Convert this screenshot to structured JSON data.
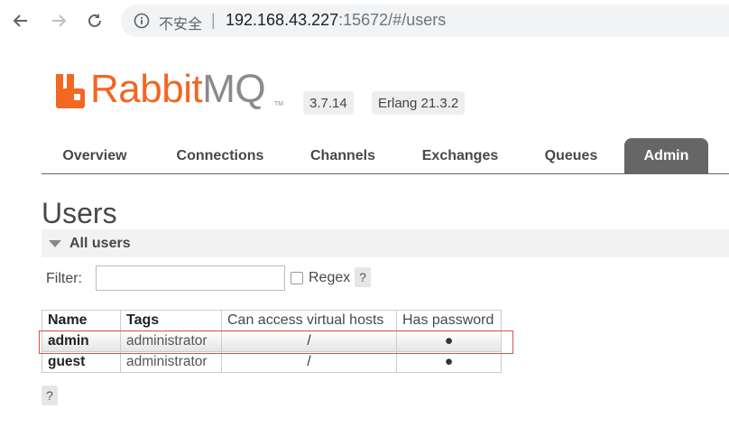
{
  "browser": {
    "security_label": "不安全",
    "separator": "|",
    "url_host": "192.168.43.227",
    "url_rest": ":15672/#/users"
  },
  "header": {
    "logo_rabbit": "Rabbit",
    "logo_mq": "MQ",
    "logo_tm": "TM",
    "version": "3.7.14",
    "erlang": "Erlang 21.3.2"
  },
  "tabs": [
    {
      "label": "Overview",
      "active": false
    },
    {
      "label": "Connections",
      "active": false
    },
    {
      "label": "Channels",
      "active": false
    },
    {
      "label": "Exchanges",
      "active": false
    },
    {
      "label": "Queues",
      "active": false
    },
    {
      "label": "Admin",
      "active": true
    }
  ],
  "page": {
    "title": "Users",
    "section": "All users",
    "filter_label": "Filter:",
    "filter_value": "",
    "regex_label": "Regex",
    "help": "?"
  },
  "table": {
    "headers": [
      "Name",
      "Tags",
      "Can access virtual hosts",
      "Has password"
    ],
    "rows": [
      {
        "name": "admin",
        "tags": "administrator",
        "vhosts": "/",
        "has_password": "●"
      },
      {
        "name": "guest",
        "tags": "administrator",
        "vhosts": "/",
        "has_password": "●"
      }
    ]
  },
  "colors": {
    "brand_orange": "#f26722",
    "active_tab": "#666666",
    "highlight_border": "#d9534f"
  }
}
